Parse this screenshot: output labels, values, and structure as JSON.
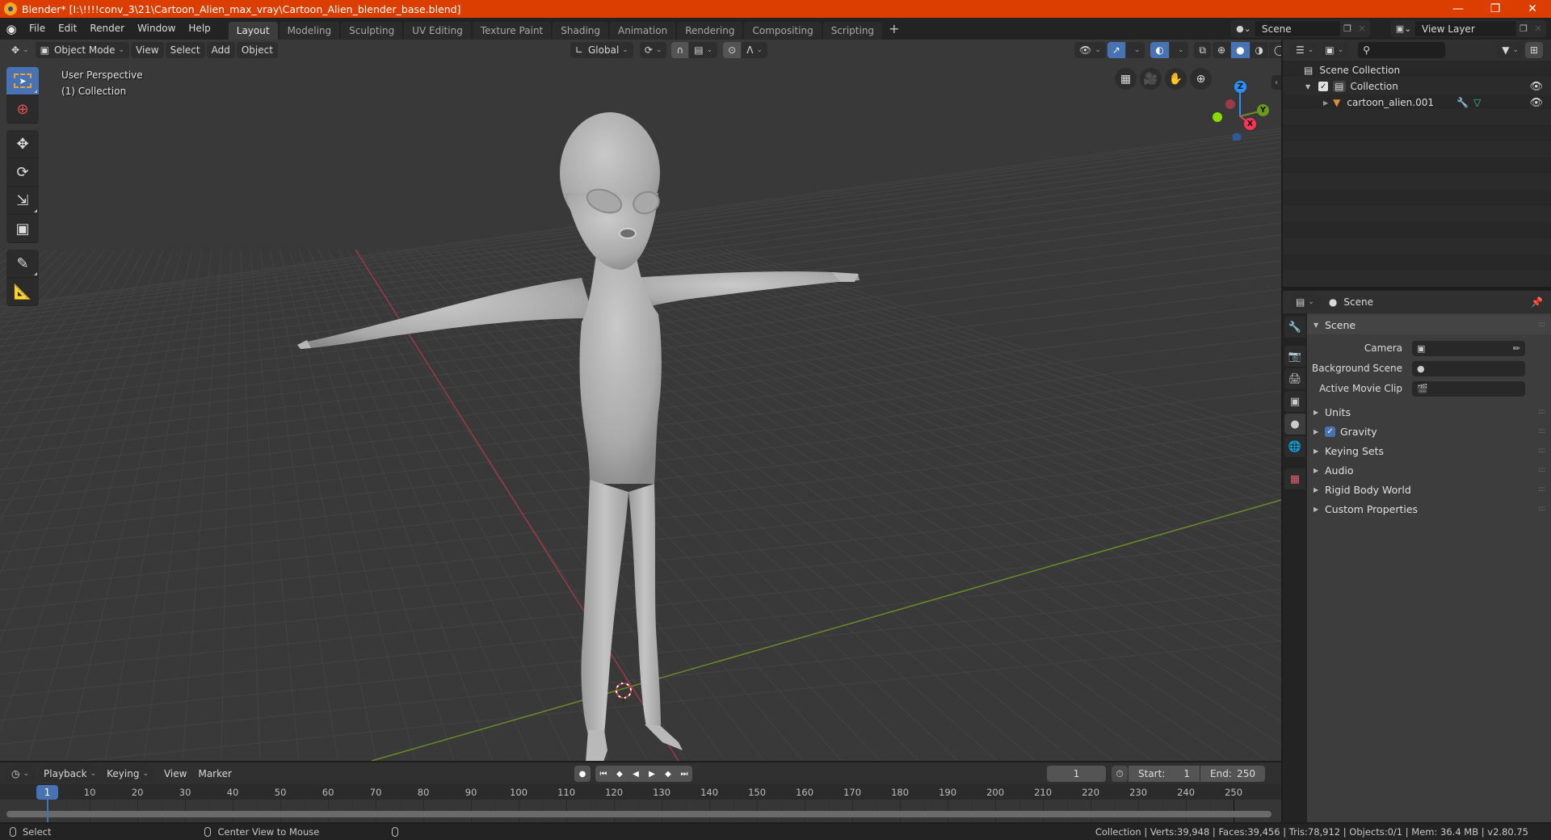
{
  "window": {
    "title": "Blender* [I:\\!!!!conv_3\\21\\Cartoon_Alien_max_vray\\Cartoon_Alien_blender_base.blend]",
    "controls": [
      "minimize",
      "restore",
      "close"
    ]
  },
  "topbar": {
    "menus": [
      "File",
      "Edit",
      "Render",
      "Window",
      "Help"
    ],
    "workspaces": [
      "Layout",
      "Modeling",
      "Sculpting",
      "UV Editing",
      "Texture Paint",
      "Shading",
      "Animation",
      "Rendering",
      "Compositing",
      "Scripting"
    ],
    "active_workspace": "Layout",
    "add_tab": "+",
    "scene_name": "Scene",
    "view_layer": "View Layer"
  },
  "viewport": {
    "mode": "Object Mode",
    "menus": [
      "View",
      "Select",
      "Add",
      "Object"
    ],
    "orientation": "Global",
    "info_line1": "User Perspective",
    "info_line2": "(1) Collection",
    "tools": [
      "select-box",
      "cursor",
      "move",
      "rotate",
      "scale",
      "transform",
      "annotate",
      "measure"
    ],
    "active_tool": "select-box",
    "shading_mode": "solid",
    "gizmo_axes": [
      "Z",
      "Y",
      "X"
    ],
    "object_name": "cartoon_alien.001"
  },
  "outliner": {
    "search_placeholder": "",
    "root": "Scene Collection",
    "collection": "Collection",
    "collection_checked": true,
    "object": "cartoon_alien.001"
  },
  "properties": {
    "context": "Scene",
    "panel_title": "Scene",
    "fields": [
      {
        "label": "Camera",
        "value": ""
      },
      {
        "label": "Background Scene",
        "value": ""
      },
      {
        "label": "Active Movie Clip",
        "value": ""
      }
    ],
    "collapsed_panels": [
      "Units",
      "Gravity",
      "Keying Sets",
      "Audio",
      "Rigid Body World",
      "Custom Properties"
    ],
    "gravity_enabled": true
  },
  "timeline": {
    "menus": [
      "Playback",
      "Keying",
      "View",
      "Marker"
    ],
    "current_frame": "1",
    "start_label": "Start:",
    "start": "1",
    "end_label": "End:",
    "end": "250",
    "ruler_ticks": [
      "10",
      "20",
      "30",
      "40",
      "50",
      "60",
      "70",
      "80",
      "90",
      "100",
      "110",
      "120",
      "130",
      "140",
      "150",
      "160",
      "170",
      "180",
      "190",
      "200",
      "210",
      "220",
      "230",
      "240",
      "250"
    ],
    "playhead_label": "1"
  },
  "statusbar": {
    "left_hint": "Select",
    "middle_hint": "Center View to Mouse",
    "stats": "Collection | Verts:39,948 | Faces:39,456 | Tris:78,912 | Objects:0/1 | Mem: 36.4 MB | v2.80.75"
  },
  "colors": {
    "titlebar": "#dc3d00",
    "accent": "#4772b3",
    "x_axis": "#ff3352",
    "y_axis": "#8bdc00",
    "z_axis": "#2890ff"
  }
}
